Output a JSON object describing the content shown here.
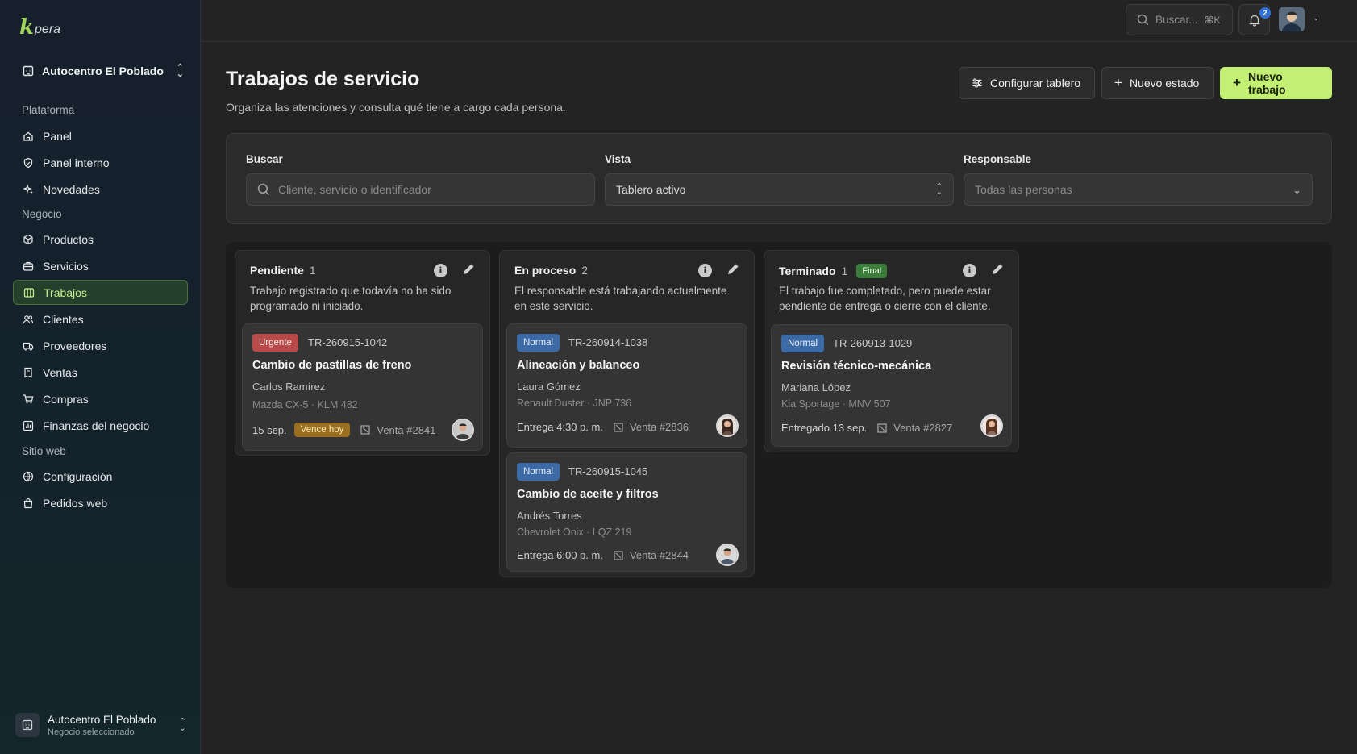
{
  "app": {
    "logo_k": "k",
    "logo_text": "pera"
  },
  "sidebar": {
    "business_name": "Autocentro El Poblado",
    "sections": [
      {
        "label": "Plataforma"
      },
      {
        "label": "Negocio"
      },
      {
        "label": "Sitio web"
      }
    ],
    "items": [
      {
        "label": "Panel",
        "icon": "home-icon"
      },
      {
        "label": "Panel interno",
        "icon": "shield-icon"
      },
      {
        "label": "Novedades",
        "icon": "sparkles-icon"
      },
      {
        "label": "Productos",
        "icon": "box-icon"
      },
      {
        "label": "Servicios",
        "icon": "briefcase-icon"
      },
      {
        "label": "Trabajos",
        "icon": "board-icon",
        "active": true
      },
      {
        "label": "Clientes",
        "icon": "users-icon"
      },
      {
        "label": "Proveedores",
        "icon": "truck-icon"
      },
      {
        "label": "Ventas",
        "icon": "receipt-icon"
      },
      {
        "label": "Compras",
        "icon": "cart-icon"
      },
      {
        "label": "Finanzas del negocio",
        "icon": "chart-icon"
      },
      {
        "label": "Configuración",
        "icon": "globe-icon"
      },
      {
        "label": "Pedidos web",
        "icon": "bag-icon"
      }
    ],
    "footer": {
      "name": "Autocentro El Poblado",
      "subtitle": "Negocio seleccionado"
    }
  },
  "topbar": {
    "search_placeholder": "Buscar...",
    "search_shortcut": "⌘K",
    "notifications_count": "2"
  },
  "header": {
    "title": "Trabajos de servicio",
    "subtitle": "Organiza las atenciones y consulta qué tiene a cargo cada persona.",
    "buttons": {
      "configure": "Configurar tablero",
      "new_state": "Nuevo estado",
      "new_job": "Nuevo trabajo"
    }
  },
  "filters": {
    "search_label": "Buscar",
    "search_placeholder": "Cliente, servicio o identificador",
    "view_label": "Vista",
    "view_value": "Tablero activo",
    "owner_label": "Responsable",
    "owner_value": "Todas las personas"
  },
  "board": {
    "columns": [
      {
        "name": "Pendiente",
        "count": "1",
        "badge": "",
        "description": "Trabajo registrado que todavía no ha sido programado ni iniciado.",
        "cards": [
          {
            "priority": "Urgente",
            "id": "TR-260915-1042",
            "title": "Cambio de pastillas de freno",
            "client": "Carlos Ramírez",
            "vehicle": "Mazda CX-5 · KLM 482",
            "date": "15 sep.",
            "due": "Vence hoy",
            "sale": "Venta #2841"
          }
        ]
      },
      {
        "name": "En proceso",
        "count": "2",
        "badge": "",
        "description": "El responsable está trabajando actualmente en este servicio.",
        "cards": [
          {
            "priority": "Normal",
            "id": "TR-260914-1038",
            "title": "Alineación y balanceo",
            "client": "Laura Gómez",
            "vehicle": "Renault Duster · JNP 736",
            "date": "Entrega 4:30 p. m.",
            "due": "",
            "sale": "Venta #2836"
          },
          {
            "priority": "Normal",
            "id": "TR-260915-1045",
            "title": "Cambio de aceite y filtros",
            "client": "Andrés Torres",
            "vehicle": "Chevrolet Onix · LQZ 219",
            "date": "Entrega 6:00 p. m.",
            "due": "",
            "sale": "Venta #2844"
          }
        ]
      },
      {
        "name": "Terminado",
        "count": "1",
        "badge": "Final",
        "description": "El trabajo fue completado, pero puede estar pendiente de entrega o cierre con el cliente.",
        "cards": [
          {
            "priority": "Normal",
            "id": "TR-260913-1029",
            "title": "Revisión técnico-mecánica",
            "client": "Mariana López",
            "vehicle": "Kia Sportage · MNV 507",
            "date": "Entregado 13 sep.",
            "due": "",
            "sale": "Venta #2827"
          }
        ]
      }
    ]
  },
  "colors": {
    "accent": "#c4ef75",
    "urgent": "#b84a4a",
    "normal": "#3c6aa6",
    "due": "#9a6f1f",
    "final": "#3c7d3c"
  }
}
